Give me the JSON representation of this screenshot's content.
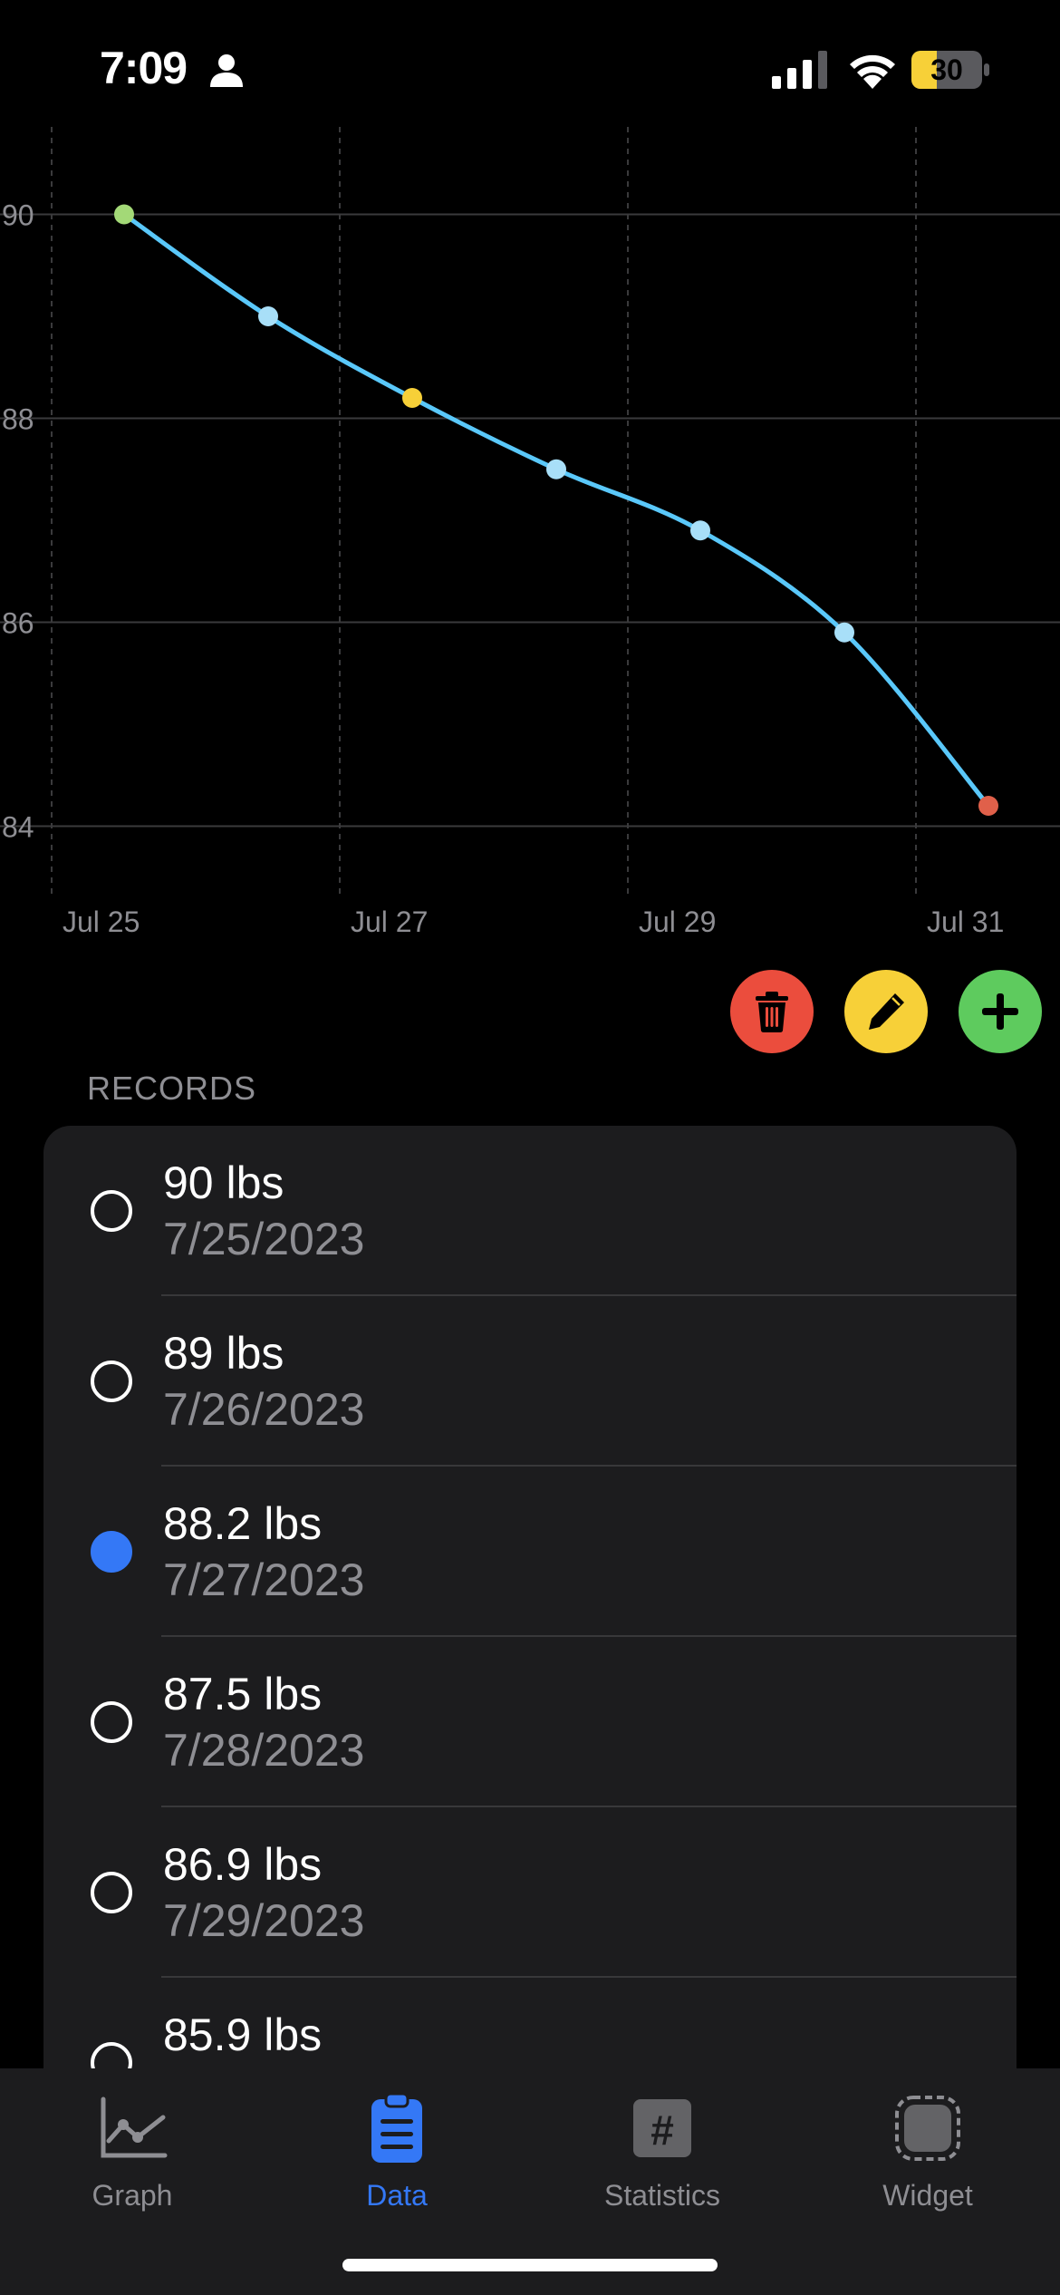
{
  "status_bar": {
    "time": "7:09",
    "battery": "30"
  },
  "chart_data": {
    "type": "line",
    "x_tick_labels": [
      "Jul 25",
      "Jul 27",
      "Jul 29",
      "Jul 31"
    ],
    "y_tick_labels": [
      "90",
      "88",
      "86",
      "84"
    ],
    "x": [
      "2023-07-25",
      "2023-07-26",
      "2023-07-27",
      "2023-07-28",
      "2023-07-29",
      "2023-07-30",
      "2023-07-31"
    ],
    "series": [
      {
        "values": [
          90,
          89,
          88.2,
          87.5,
          86.9,
          85.9,
          84.2
        ]
      }
    ],
    "ylim": [
      83,
      91
    ],
    "grid": true,
    "colors": {
      "line": "#5ac8fa",
      "first_point": "#a3d977",
      "selected_point": "#f7d038",
      "last_point": "#e0604a",
      "point": "#a8dff8"
    }
  },
  "actions": {
    "delete_icon": "trash-icon",
    "edit_icon": "pencil-icon",
    "add_icon": "plus-icon"
  },
  "records": {
    "header": "RECORDS",
    "items": [
      {
        "weight": "90 lbs",
        "date": "7/25/2023",
        "selected": false
      },
      {
        "weight": "89 lbs",
        "date": "7/26/2023",
        "selected": false
      },
      {
        "weight": "88.2 lbs",
        "date": "7/27/2023",
        "selected": true
      },
      {
        "weight": "87.5 lbs",
        "date": "7/28/2023",
        "selected": false
      },
      {
        "weight": "86.9 lbs",
        "date": "7/29/2023",
        "selected": false
      },
      {
        "weight": "85.9 lbs",
        "date": "",
        "selected": false
      }
    ]
  },
  "tabs": [
    {
      "label": "Graph",
      "icon": "chart-icon",
      "active": false
    },
    {
      "label": "Data",
      "icon": "clipboard-icon",
      "active": true
    },
    {
      "label": "Statistics",
      "icon": "hashtag-icon",
      "active": false
    },
    {
      "label": "Widget",
      "icon": "widget-icon",
      "active": false
    }
  ],
  "colors": {
    "accent": "#3478f6",
    "background": "#000000",
    "card": "#1c1c1e"
  }
}
